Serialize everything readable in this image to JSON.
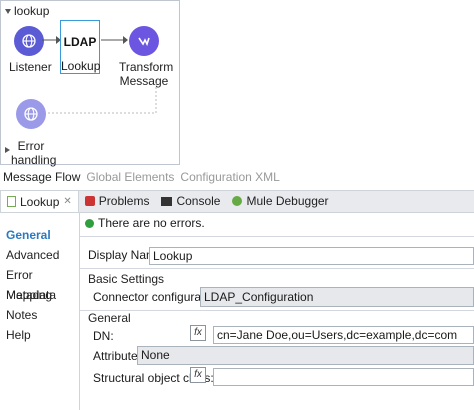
{
  "flow": {
    "name": "lookup",
    "nodes": {
      "listener": "Listener",
      "ldap_title": "LDAP",
      "lookup": "Lookup",
      "transform_line1": "Transform",
      "transform_line2": "Message",
      "error_line1": "Error",
      "error_line2": "handling"
    },
    "view_tabs": [
      "Message Flow",
      "Global Elements",
      "Configuration XML"
    ]
  },
  "editor_tabs": {
    "lookup": "Lookup",
    "problems": "Problems",
    "console": "Console",
    "debugger": "Mule Debugger"
  },
  "nav": [
    "General",
    "Advanced",
    "Error Mapping",
    "Metadata",
    "Notes",
    "Help"
  ],
  "form": {
    "status": "There are no errors.",
    "display_name_label": "Display Name:",
    "display_name_value": "Lookup",
    "basic_settings": "Basic Settings",
    "connector_label": "Connector configuration:",
    "connector_value": "LDAP_Configuration",
    "general": "General",
    "dn_label": "DN:",
    "dn_value": "cn=Jane Doe,ou=Users,dc=example,dc=com",
    "attributes_label": "Attributes",
    "attributes_value": "None",
    "structural_label": "Structural object class:",
    "fx": "fx"
  },
  "colors": {
    "accent": "#2b79c2",
    "node_blue": "#5b5bd6",
    "success": "#2e9e3e"
  }
}
